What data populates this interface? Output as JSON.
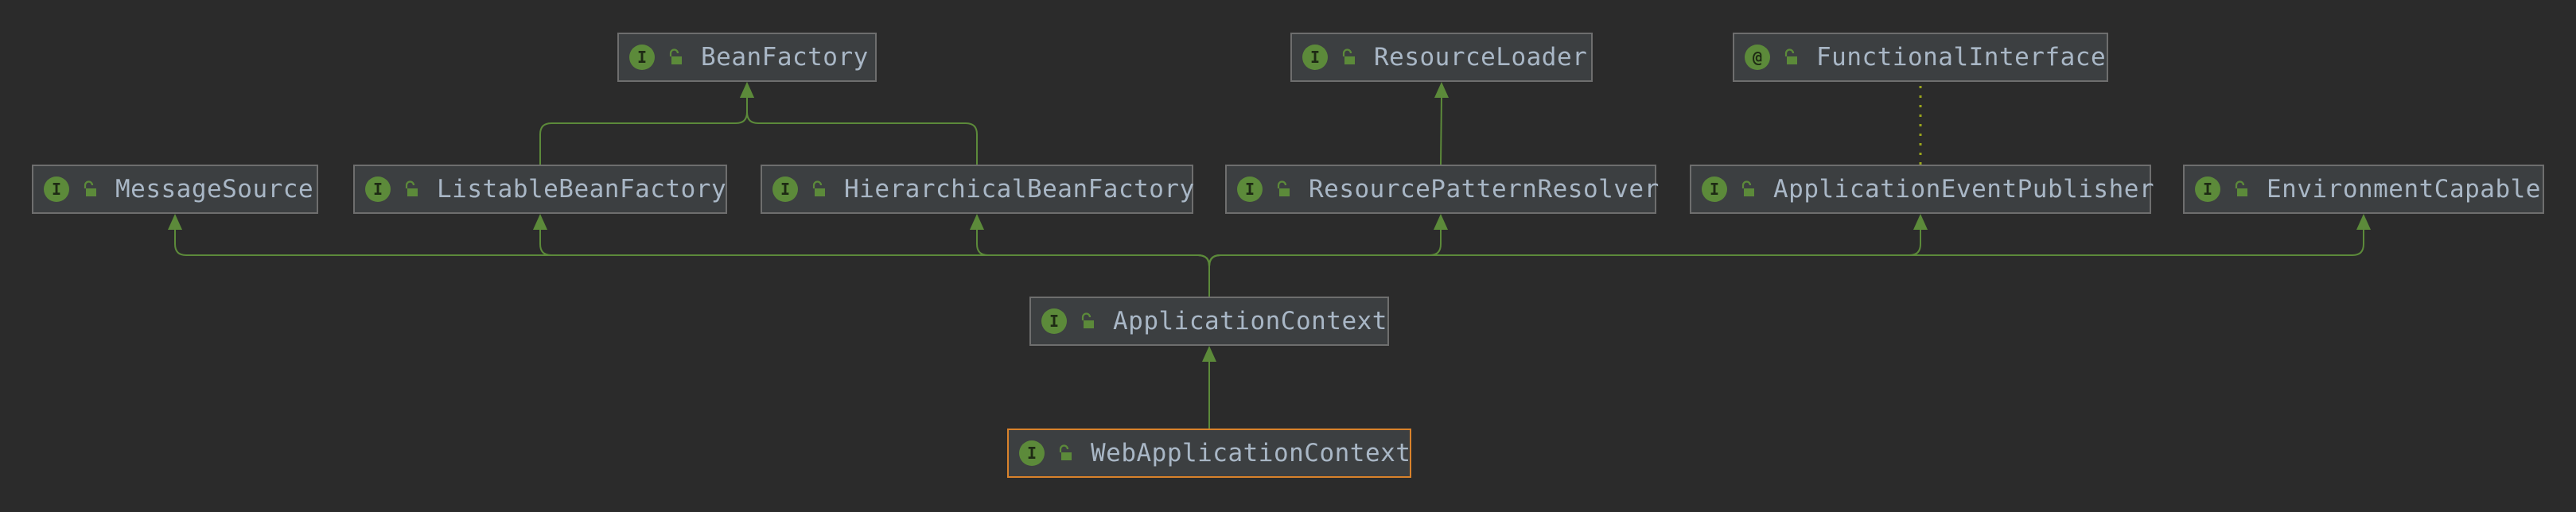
{
  "diagram": {
    "colors": {
      "background": "#2b2b2b",
      "node_fill": "#3c3f41",
      "node_border": "#6e6e6e",
      "selected_border": "#d9822b",
      "edge": "#5c8a3a",
      "dotted_edge": "#9aa51b",
      "badge": "#5c8a3a",
      "text": "#a9b7c6"
    },
    "nodes": [
      {
        "id": "BeanFactory",
        "label": "BeanFactory",
        "badge": "I",
        "icon": "unlocked-padlock-icon"
      },
      {
        "id": "ResourceLoader",
        "label": "ResourceLoader",
        "badge": "I",
        "icon": "unlocked-padlock-icon"
      },
      {
        "id": "FunctionalInterface",
        "label": "FunctionalInterface",
        "badge": "@",
        "icon": "unlocked-padlock-icon"
      },
      {
        "id": "MessageSource",
        "label": "MessageSource",
        "badge": "I",
        "icon": "unlocked-padlock-icon"
      },
      {
        "id": "ListableBeanFactory",
        "label": "ListableBeanFactory",
        "badge": "I",
        "icon": "unlocked-padlock-icon"
      },
      {
        "id": "HierarchicalBeanFactory",
        "label": "HierarchicalBeanFactory",
        "badge": "I",
        "icon": "unlocked-padlock-icon"
      },
      {
        "id": "ResourcePatternResolver",
        "label": "ResourcePatternResolver",
        "badge": "I",
        "icon": "unlocked-padlock-icon"
      },
      {
        "id": "ApplicationEventPublisher",
        "label": "ApplicationEventPublisher",
        "badge": "I",
        "icon": "unlocked-padlock-icon"
      },
      {
        "id": "EnvironmentCapable",
        "label": "EnvironmentCapable",
        "badge": "I",
        "icon": "unlocked-padlock-icon"
      },
      {
        "id": "ApplicationContext",
        "label": "ApplicationContext",
        "badge": "I",
        "icon": "unlocked-padlock-icon"
      },
      {
        "id": "WebApplicationContext",
        "label": "WebApplicationContext",
        "badge": "I",
        "icon": "unlocked-padlock-icon",
        "selected": true
      }
    ],
    "edges": [
      {
        "from": "ListableBeanFactory",
        "to": "BeanFactory",
        "style": "solid"
      },
      {
        "from": "HierarchicalBeanFactory",
        "to": "BeanFactory",
        "style": "solid"
      },
      {
        "from": "ResourcePatternResolver",
        "to": "ResourceLoader",
        "style": "solid"
      },
      {
        "from": "ApplicationEventPublisher",
        "to": "FunctionalInterface",
        "style": "dotted"
      },
      {
        "from": "ApplicationContext",
        "to": "MessageSource",
        "style": "solid"
      },
      {
        "from": "ApplicationContext",
        "to": "ListableBeanFactory",
        "style": "solid"
      },
      {
        "from": "ApplicationContext",
        "to": "HierarchicalBeanFactory",
        "style": "solid"
      },
      {
        "from": "ApplicationContext",
        "to": "ResourcePatternResolver",
        "style": "solid"
      },
      {
        "from": "ApplicationContext",
        "to": "ApplicationEventPublisher",
        "style": "solid"
      },
      {
        "from": "ApplicationContext",
        "to": "EnvironmentCapable",
        "style": "solid"
      },
      {
        "from": "WebApplicationContext",
        "to": "ApplicationContext",
        "style": "solid"
      }
    ]
  }
}
